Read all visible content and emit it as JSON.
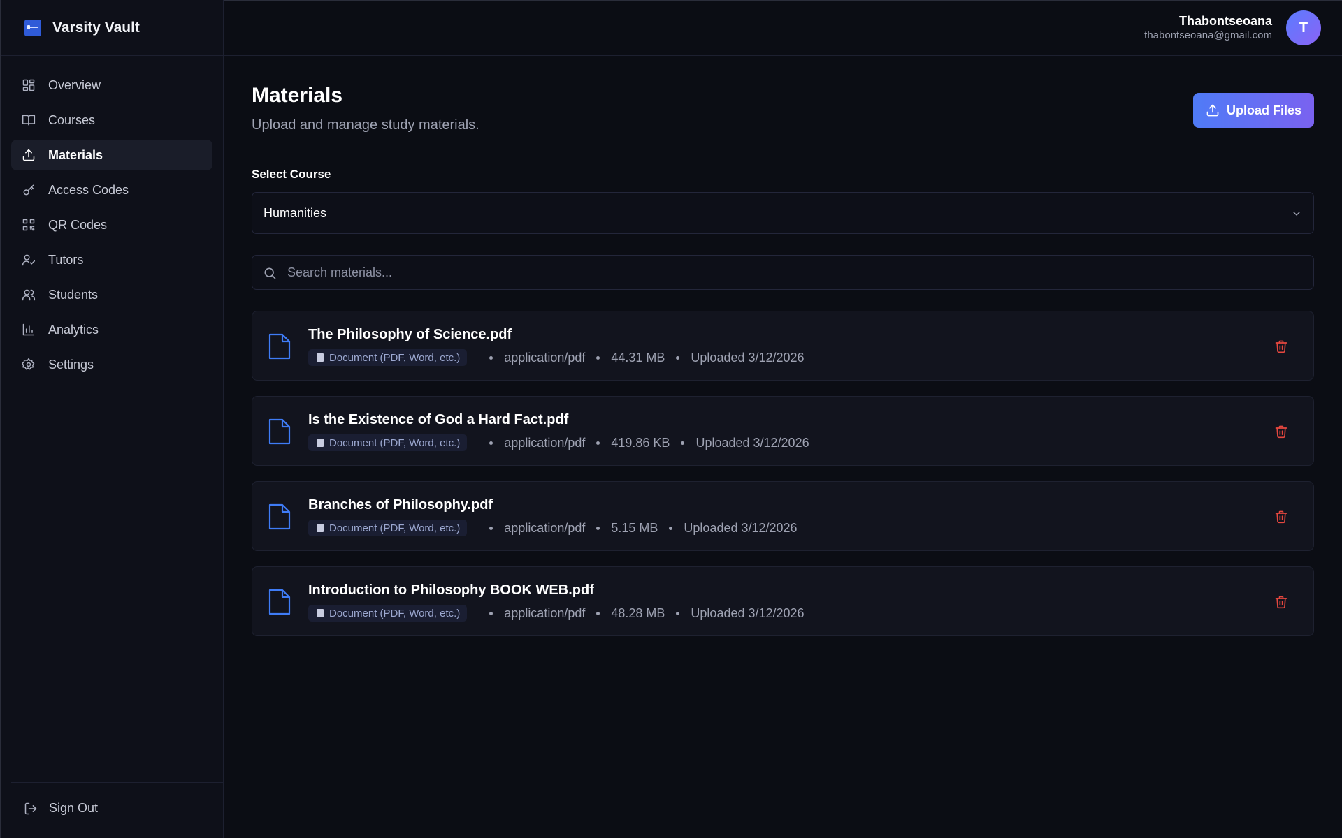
{
  "app": {
    "name": "Varsity Vault"
  },
  "sidebar": {
    "items": [
      {
        "label": "Overview",
        "icon": "grid-icon",
        "active": false
      },
      {
        "label": "Courses",
        "icon": "book-icon",
        "active": false
      },
      {
        "label": "Materials",
        "icon": "upload-icon",
        "active": true
      },
      {
        "label": "Access Codes",
        "icon": "key-icon",
        "active": false
      },
      {
        "label": "QR Codes",
        "icon": "qr-code-icon",
        "active": false
      },
      {
        "label": "Tutors",
        "icon": "user-check-icon",
        "active": false
      },
      {
        "label": "Students",
        "icon": "users-icon",
        "active": false
      },
      {
        "label": "Analytics",
        "icon": "bar-chart-icon",
        "active": false
      },
      {
        "label": "Settings",
        "icon": "gear-icon",
        "active": false
      }
    ],
    "signout_label": "Sign Out"
  },
  "header": {
    "user_name": "Thabontseoana",
    "user_email": "thabontseoana@gmail.com",
    "avatar_initial": "T"
  },
  "main": {
    "title": "Materials",
    "subtitle": "Upload and manage study materials.",
    "upload_label": "Upload Files",
    "select_label": "Select Course",
    "selected_course": "Humanities",
    "search_placeholder": "Search materials...",
    "files": [
      {
        "name": "The Philosophy of Science.pdf",
        "badge": "Document (PDF, Word, etc.)",
        "mime": "application/pdf",
        "size": "44.31 MB",
        "uploaded": "Uploaded 3/12/2026"
      },
      {
        "name": "Is the Existence of God a Hard Fact.pdf",
        "badge": "Document (PDF, Word, etc.)",
        "mime": "application/pdf",
        "size": "419.86 KB",
        "uploaded": "Uploaded 3/12/2026"
      },
      {
        "name": "Branches of Philosophy.pdf",
        "badge": "Document (PDF, Word, etc.)",
        "mime": "application/pdf",
        "size": "5.15 MB",
        "uploaded": "Uploaded 3/12/2026"
      },
      {
        "name": "Introduction to Philosophy BOOK WEB.pdf",
        "badge": "Document (PDF, Word, etc.)",
        "mime": "application/pdf",
        "size": "48.28 MB",
        "uploaded": "Uploaded 3/12/2026"
      }
    ]
  },
  "colors": {
    "background": "#0b0d14",
    "accent_start": "#4f7bf7",
    "accent_end": "#7a62f0",
    "file_icon": "#3f7cf6",
    "delete": "#e5473f"
  }
}
